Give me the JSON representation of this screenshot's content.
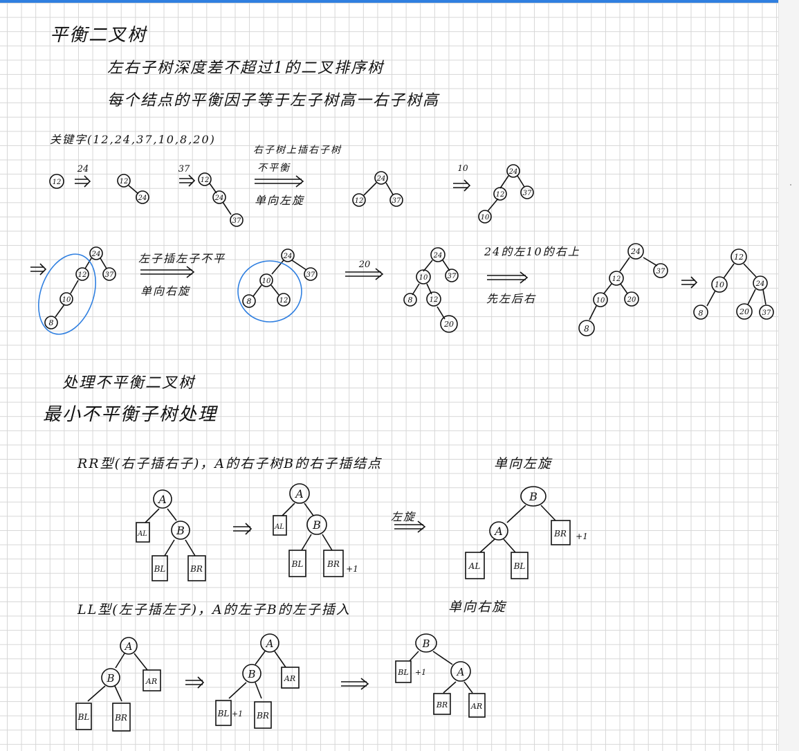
{
  "notes": {
    "title": "平衡二叉树",
    "definition": "左右子树深度差不超过1的二叉排序树",
    "balance_factor": "每个结点的平衡因子等于左子树高一右子树高",
    "keywords": "关键字(12,24,37,10,8,20)",
    "rr_caption": "右子树上插右子树",
    "unbalanced": "不平衡",
    "single_left": "单向左旋",
    "single_right": "单向右旋",
    "insert_right_label": "左子插左子不平",
    "double_label": "24的左10的右上",
    "left_then_right": "先左后右",
    "handle": "处理不平衡二叉树",
    "min_subtree": "最小不平衡子树处理",
    "rr_type": "RR型(右子插右子)，A的右子树B的右子插结点",
    "rr_rotate": "单向左旋",
    "left_rotate_label": "左旋",
    "ll_type": "LL型(左子插左子)，A的左子B的左子插入",
    "ll_rotate": "单向右旋"
  },
  "arrow_values": {
    "a24": "24",
    "a37": "37",
    "a10": "10",
    "a20": "20"
  },
  "nodes": {
    "n12": "12",
    "n24": "24",
    "n37": "37",
    "n10": "10",
    "n8": "8",
    "n20": "20",
    "A": "A",
    "B": "B",
    "AL": "AL",
    "AR": "AR",
    "BL": "BL",
    "BR": "BR",
    "plus1": "+1"
  },
  "colors": {
    "ink": "#111111",
    "highlight": "#2f7fe0",
    "grid": "#d6d6d6"
  }
}
